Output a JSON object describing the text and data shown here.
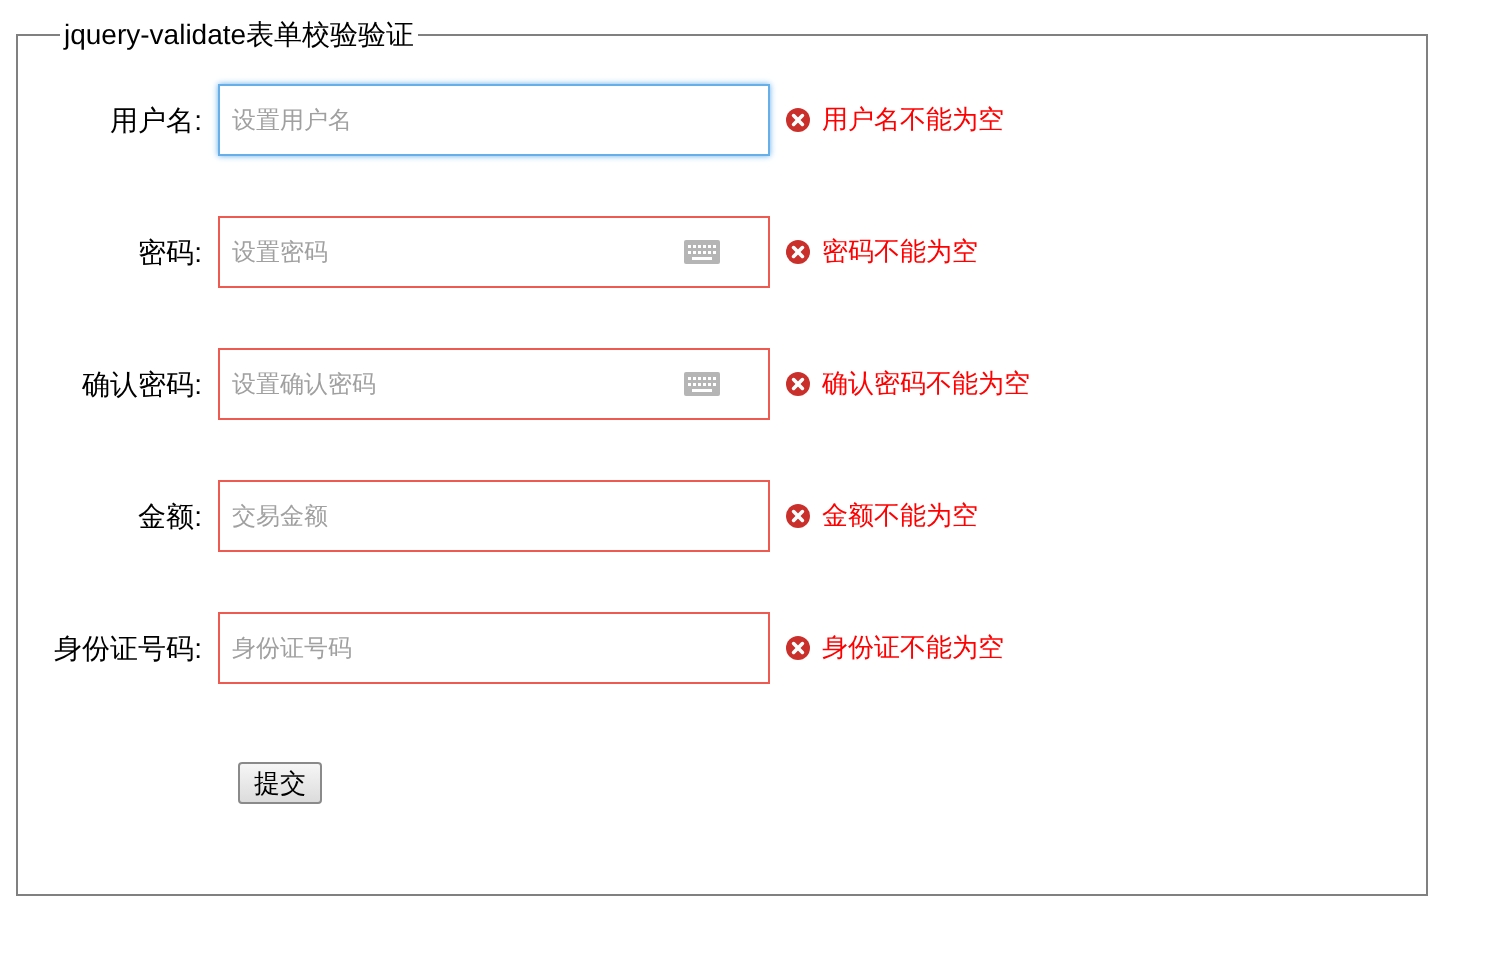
{
  "form": {
    "legend": "jquery-validate表单校验验证",
    "fields": [
      {
        "label": "用户名:",
        "placeholder": "设置用户名",
        "kind": "text",
        "focused": true,
        "error": "用户名不能为空"
      },
      {
        "label": "密码:",
        "placeholder": "设置密码",
        "kind": "password",
        "focused": false,
        "error": "密码不能为空"
      },
      {
        "label": "确认密码:",
        "placeholder": "设置确认密码",
        "kind": "password",
        "focused": false,
        "error": "确认密码不能为空"
      },
      {
        "label": "金额:",
        "placeholder": "交易金额",
        "kind": "text",
        "focused": false,
        "error": "金额不能为空"
      },
      {
        "label": "身份证号码:",
        "placeholder": "身份证号码",
        "kind": "text",
        "focused": false,
        "error": "身份证不能为空"
      }
    ],
    "submit": "提交"
  }
}
